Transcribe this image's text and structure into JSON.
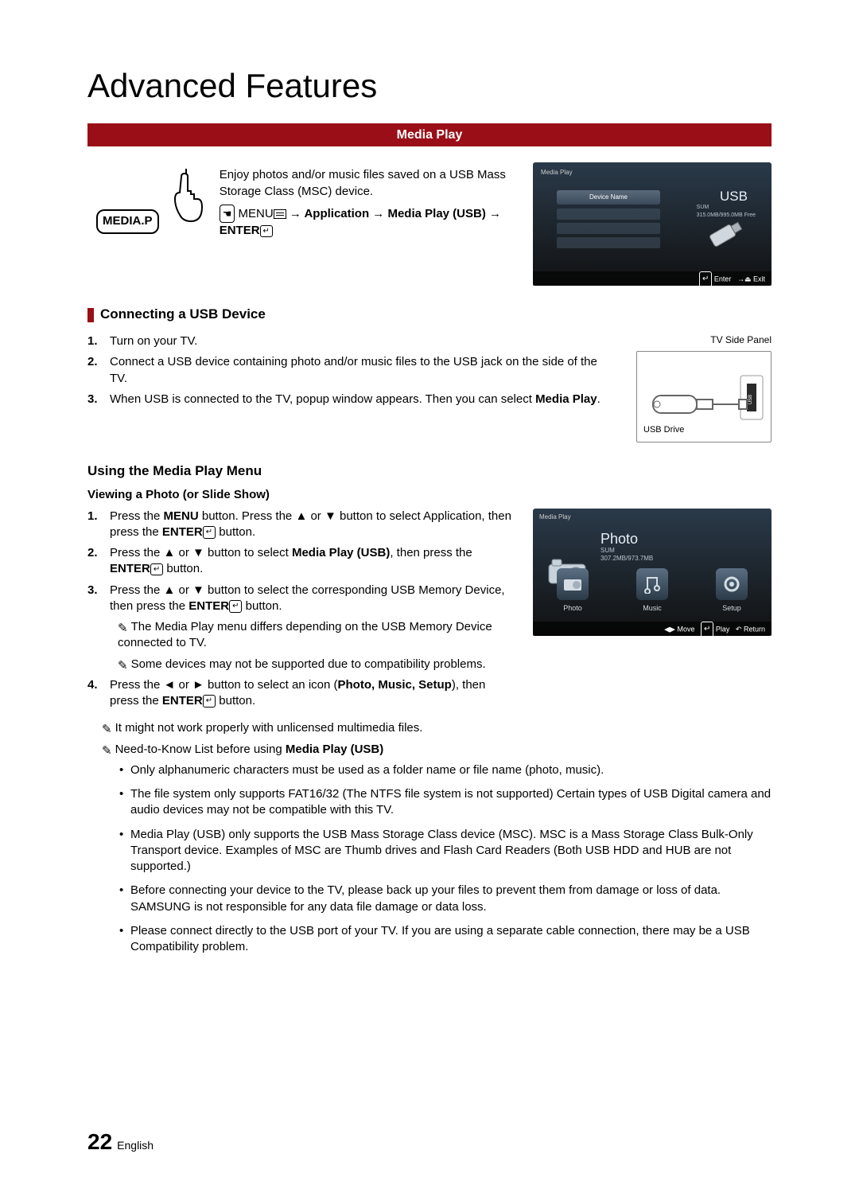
{
  "page_title": "Advanced Features",
  "section_bar": "Media Play",
  "intro": {
    "mediap_button": "MEDIA.P",
    "desc": "Enjoy photos and/or music files saved on a USB Mass Storage Class (MSC) device.",
    "path_prefix": "MENU",
    "path": " → Application → Media Play (USB) → ENTER"
  },
  "usb_screen": {
    "header": "Media Play",
    "device_name": "Device Name",
    "usb_label": "USB",
    "usb_sub1": "SUM",
    "usb_sub2": "315.0MB/995.0MB Free",
    "footer_enter": "Enter",
    "footer_exit": "Exit"
  },
  "connect_head": "Connecting a USB Device",
  "connect_steps": [
    "Turn on your TV.",
    "Connect a USB device containing photo and/or music files to the USB jack on the side of the TV.",
    "When USB is connected to the TV, popup window appears. Then you can select Media Play."
  ],
  "tv_side_panel": "TV Side Panel",
  "usb_drive": "USB Drive",
  "usb_port_label": "USB",
  "using_head": "Using the Media Play Menu",
  "viewing_head": "Viewing a Photo (or Slide Show)",
  "viewing_steps": [
    "Press the MENU button. Press the ▲ or ▼ button to select Application, then press the ENTER button.",
    "Press the ▲ or ▼ button to select Media Play (USB), then press the ENTER button.",
    "Press the ▲ or ▼ button to select the corresponding USB Memory Device, then press the ENTER button."
  ],
  "viewing_notes": [
    "The Media Play menu differs depending on the USB Memory Device connected to TV.",
    "Some devices may not be supported due to compatibility problems."
  ],
  "viewing_step4": "Press the ◄ or ► button to select an icon (Photo, Music, Setup), then press the ENTER button.",
  "photo_screen": {
    "header": "Media Play",
    "title": "Photo",
    "sub1": "SUM",
    "sub2": "307.2MB/973.7MB",
    "icons": [
      "Photo",
      "Music",
      "Setup"
    ],
    "footer_move": "Move",
    "footer_play": "Play",
    "footer_return": "Return"
  },
  "global_note1": "It might not work properly with unlicensed multimedia files.",
  "global_note2_prefix": "Need-to-Know List before using ",
  "global_note2_bold": "Media Play (USB)",
  "bullets": [
    "Only alphanumeric characters must be used as a folder name or file name (photo, music).",
    "The file system only supports FAT16/32 (The NTFS file system is not supported) Certain types of USB Digital camera and audio devices may not be compatible with this TV.",
    "Media Play (USB) only supports the USB Mass Storage Class device (MSC). MSC is a Mass Storage Class Bulk-Only Transport device. Examples of MSC are Thumb drives and Flash Card Readers (Both USB HDD and HUB are not supported.)",
    "Before connecting your device to the TV, please back up your files to prevent them from damage or loss of data. SAMSUNG is not responsible for any data file damage or data loss.",
    "Please connect directly to the USB port of your TV. If you are using a separate cable connection, there may be a USB Compatibility problem."
  ],
  "page_number": "22",
  "page_lang": "English"
}
